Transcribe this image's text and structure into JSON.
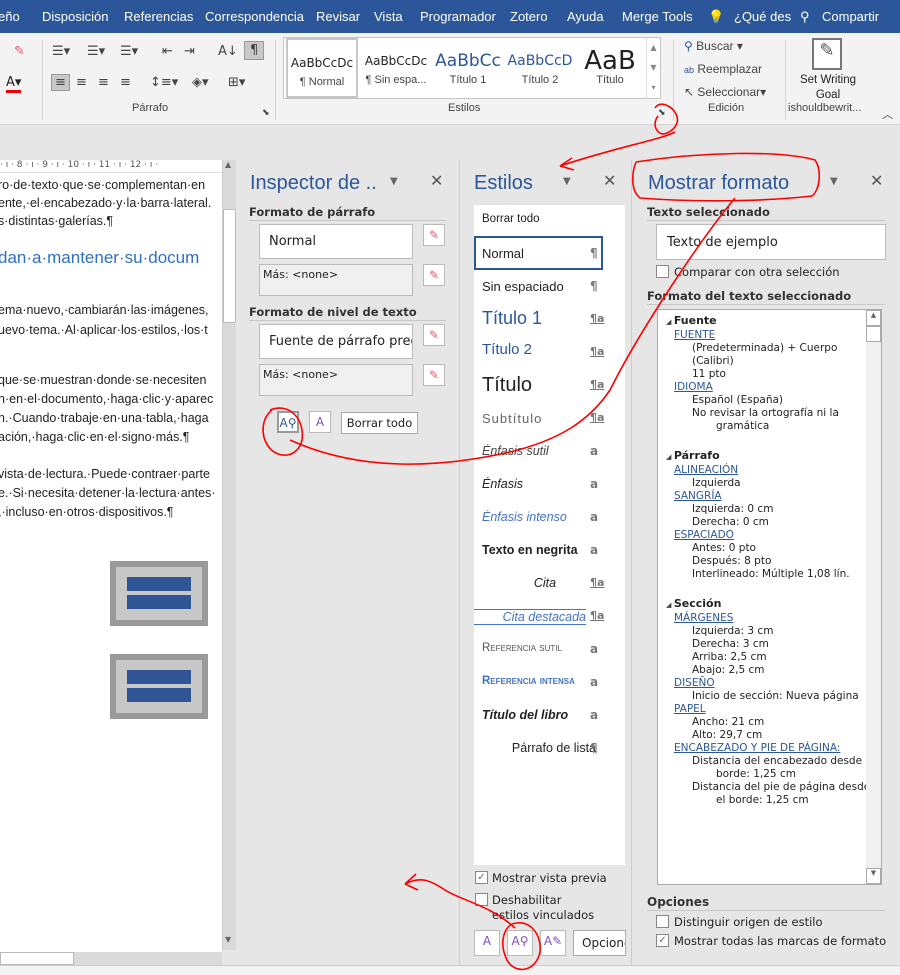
{
  "ribbon": {
    "tabs": [
      "eño",
      "Disposición",
      "Referencias",
      "Correspondencia",
      "Revisar",
      "Vista",
      "Programador",
      "Zotero",
      "Ayuda",
      "Merge Tools",
      "¿Qué des",
      "Compartir"
    ],
    "groups": {
      "paragraph": "Párrafo",
      "styles": "Estilos",
      "editing": "Edición",
      "addin": "ishouldbewrit..."
    },
    "gallery": [
      {
        "preview": "AaBbCcDc",
        "name": "¶ Normal"
      },
      {
        "preview": "AaBbCcDc",
        "name": "¶ Sin espa..."
      },
      {
        "preview": "AaBbCc",
        "name": "Título 1"
      },
      {
        "preview": "AaBbCcD",
        "name": "Título 2"
      },
      {
        "preview": "AaB",
        "name": "Título"
      }
    ],
    "editing": {
      "find": "Buscar",
      "replace": "Reemplazar",
      "select": "Seleccionar"
    },
    "addin": {
      "line1": "Set Writing",
      "line2": "Goal"
    }
  },
  "document": {
    "ruler": "· ı · 8 · ı · 9 · ı · 10 · ı · 11 · ı · 12 · ı ·",
    "lines": [
      "ro·de·texto·que·se·complementan·en",
      "ente,·el·encabezado·y·la·barra·lateral.",
      "s·distintas·galerías.¶",
      "dan·a·mantener·su·docum",
      "ema·nuevo,·cambiarán·las·imágenes,",
      "uevo·tema.·Al·aplicar·los·estilos,·los·t",
      "que·se·muestran·donde·se·necesiten",
      "n·en·el·documento,·haga·clic·y·aparec",
      "n.·Cuando·trabaje·en·una·tabla,·haga",
      "ación,·haga·clic·en·el·signo·más.¶",
      "vista·de·lectura.·Puede·contraer·parte",
      "e.·Si·necesita·detener·la·lectura·antes·",
      ",·incluso·en·otros·dispositivos.¶"
    ]
  },
  "inspector": {
    "title": "Inspector de ..",
    "paragraph_section": "Formato de párrafo",
    "paragraph_value": "Normal",
    "paragraph_more": "Más: <none>",
    "text_section": "Formato de nivel de texto",
    "text_value": "Fuente de párrafo prec",
    "text_more": "Más: <none>",
    "clear_all": "Borrar todo"
  },
  "styles": {
    "title": "Estilos",
    "items": [
      {
        "label": "Borrar todo",
        "mark": ""
      },
      {
        "label": "Normal",
        "mark": "¶"
      },
      {
        "label": "Sin espaciado",
        "mark": "¶"
      },
      {
        "label": "Título 1",
        "mark": "¶a"
      },
      {
        "label": "Título 2",
        "mark": "¶a"
      },
      {
        "label": "Título",
        "mark": "¶a"
      },
      {
        "label": "Subtítulo",
        "mark": "¶a"
      },
      {
        "label": "Énfasis sutil",
        "mark": "a"
      },
      {
        "label": "Énfasis",
        "mark": "a"
      },
      {
        "label": "Énfasis intenso",
        "mark": "a"
      },
      {
        "label": "Texto en negrita",
        "mark": "a"
      },
      {
        "label": "Cita",
        "mark": "¶a"
      },
      {
        "label": "Cita destacada",
        "mark": "¶a"
      },
      {
        "label": "Referencia sutil",
        "mark": "a"
      },
      {
        "label": "Referencia intensa",
        "mark": "a"
      },
      {
        "label": "Título del libro",
        "mark": "a"
      },
      {
        "label": "Párrafo de lista",
        "mark": "¶"
      }
    ],
    "selected": "Normal",
    "show_preview": "Mostrar vista previa",
    "show_preview_checked": true,
    "disable_linked": "Deshabilitar estilos vinculados",
    "disable_linked_checked": false,
    "options": "Opciones..."
  },
  "reveal": {
    "title": "Mostrar formato",
    "selected_text_section": "Texto seleccionado",
    "sample": "Texto de ejemplo",
    "compare": "Comparar con otra selección",
    "compare_checked": false,
    "format_section": "Formato del texto seleccionado",
    "tree": {
      "font_h": "Fuente",
      "font_link": "FUENTE",
      "font_v1": "(Predeterminada) + Cuerpo (Calibri)",
      "font_v2": "11 pto",
      "lang_link": "IDIOMA",
      "lang_v1": "Español (España)",
      "lang_v2": "No revisar la ortografía ni la",
      "lang_v3": "gramática",
      "para_h": "Párrafo",
      "align_link": "ALINEACIÓN",
      "align_v": "Izquierda",
      "indent_link": "SANGRÍA",
      "indent_v1": "Izquierda: 0 cm",
      "indent_v2": "Derecha: 0 cm",
      "spacing_link": "ESPACIADO",
      "spacing_v1": "Antes: 0 pto",
      "spacing_v2": "Después: 8 pto",
      "spacing_v3": "Interlineado: Múltiple 1,08 lín.",
      "section_h": "Sección",
      "margins_link": "MÁRGENES",
      "m1": "Izquierda: 3 cm",
      "m2": "Derecha: 3 cm",
      "m3": "Arriba: 2,5 cm",
      "m4": "Abajo: 2,5 cm",
      "layout_link": "DISEÑO",
      "layout_v": "Inicio de sección: Nueva página",
      "paper_link": "PAPEL",
      "p1": "Ancho: 21 cm",
      "p2": "Alto: 29,7 cm",
      "hf_link": "ENCABEZADO Y PIE DE PÁGINA:",
      "hf1": "Distancia del encabezado desde el",
      "hf2": "borde: 1,25 cm",
      "hf3": "Distancia del pie de página desde",
      "hf4": "el borde: 1,25 cm"
    },
    "options_section": "Opciones",
    "distinguish": "Distinguir origen de estilo",
    "distinguish_checked": false,
    "show_all": "Mostrar todas las marcas de formato",
    "show_all_checked": true
  },
  "colors": {
    "accent": "#2b579a",
    "annotation": "#ff0000"
  }
}
